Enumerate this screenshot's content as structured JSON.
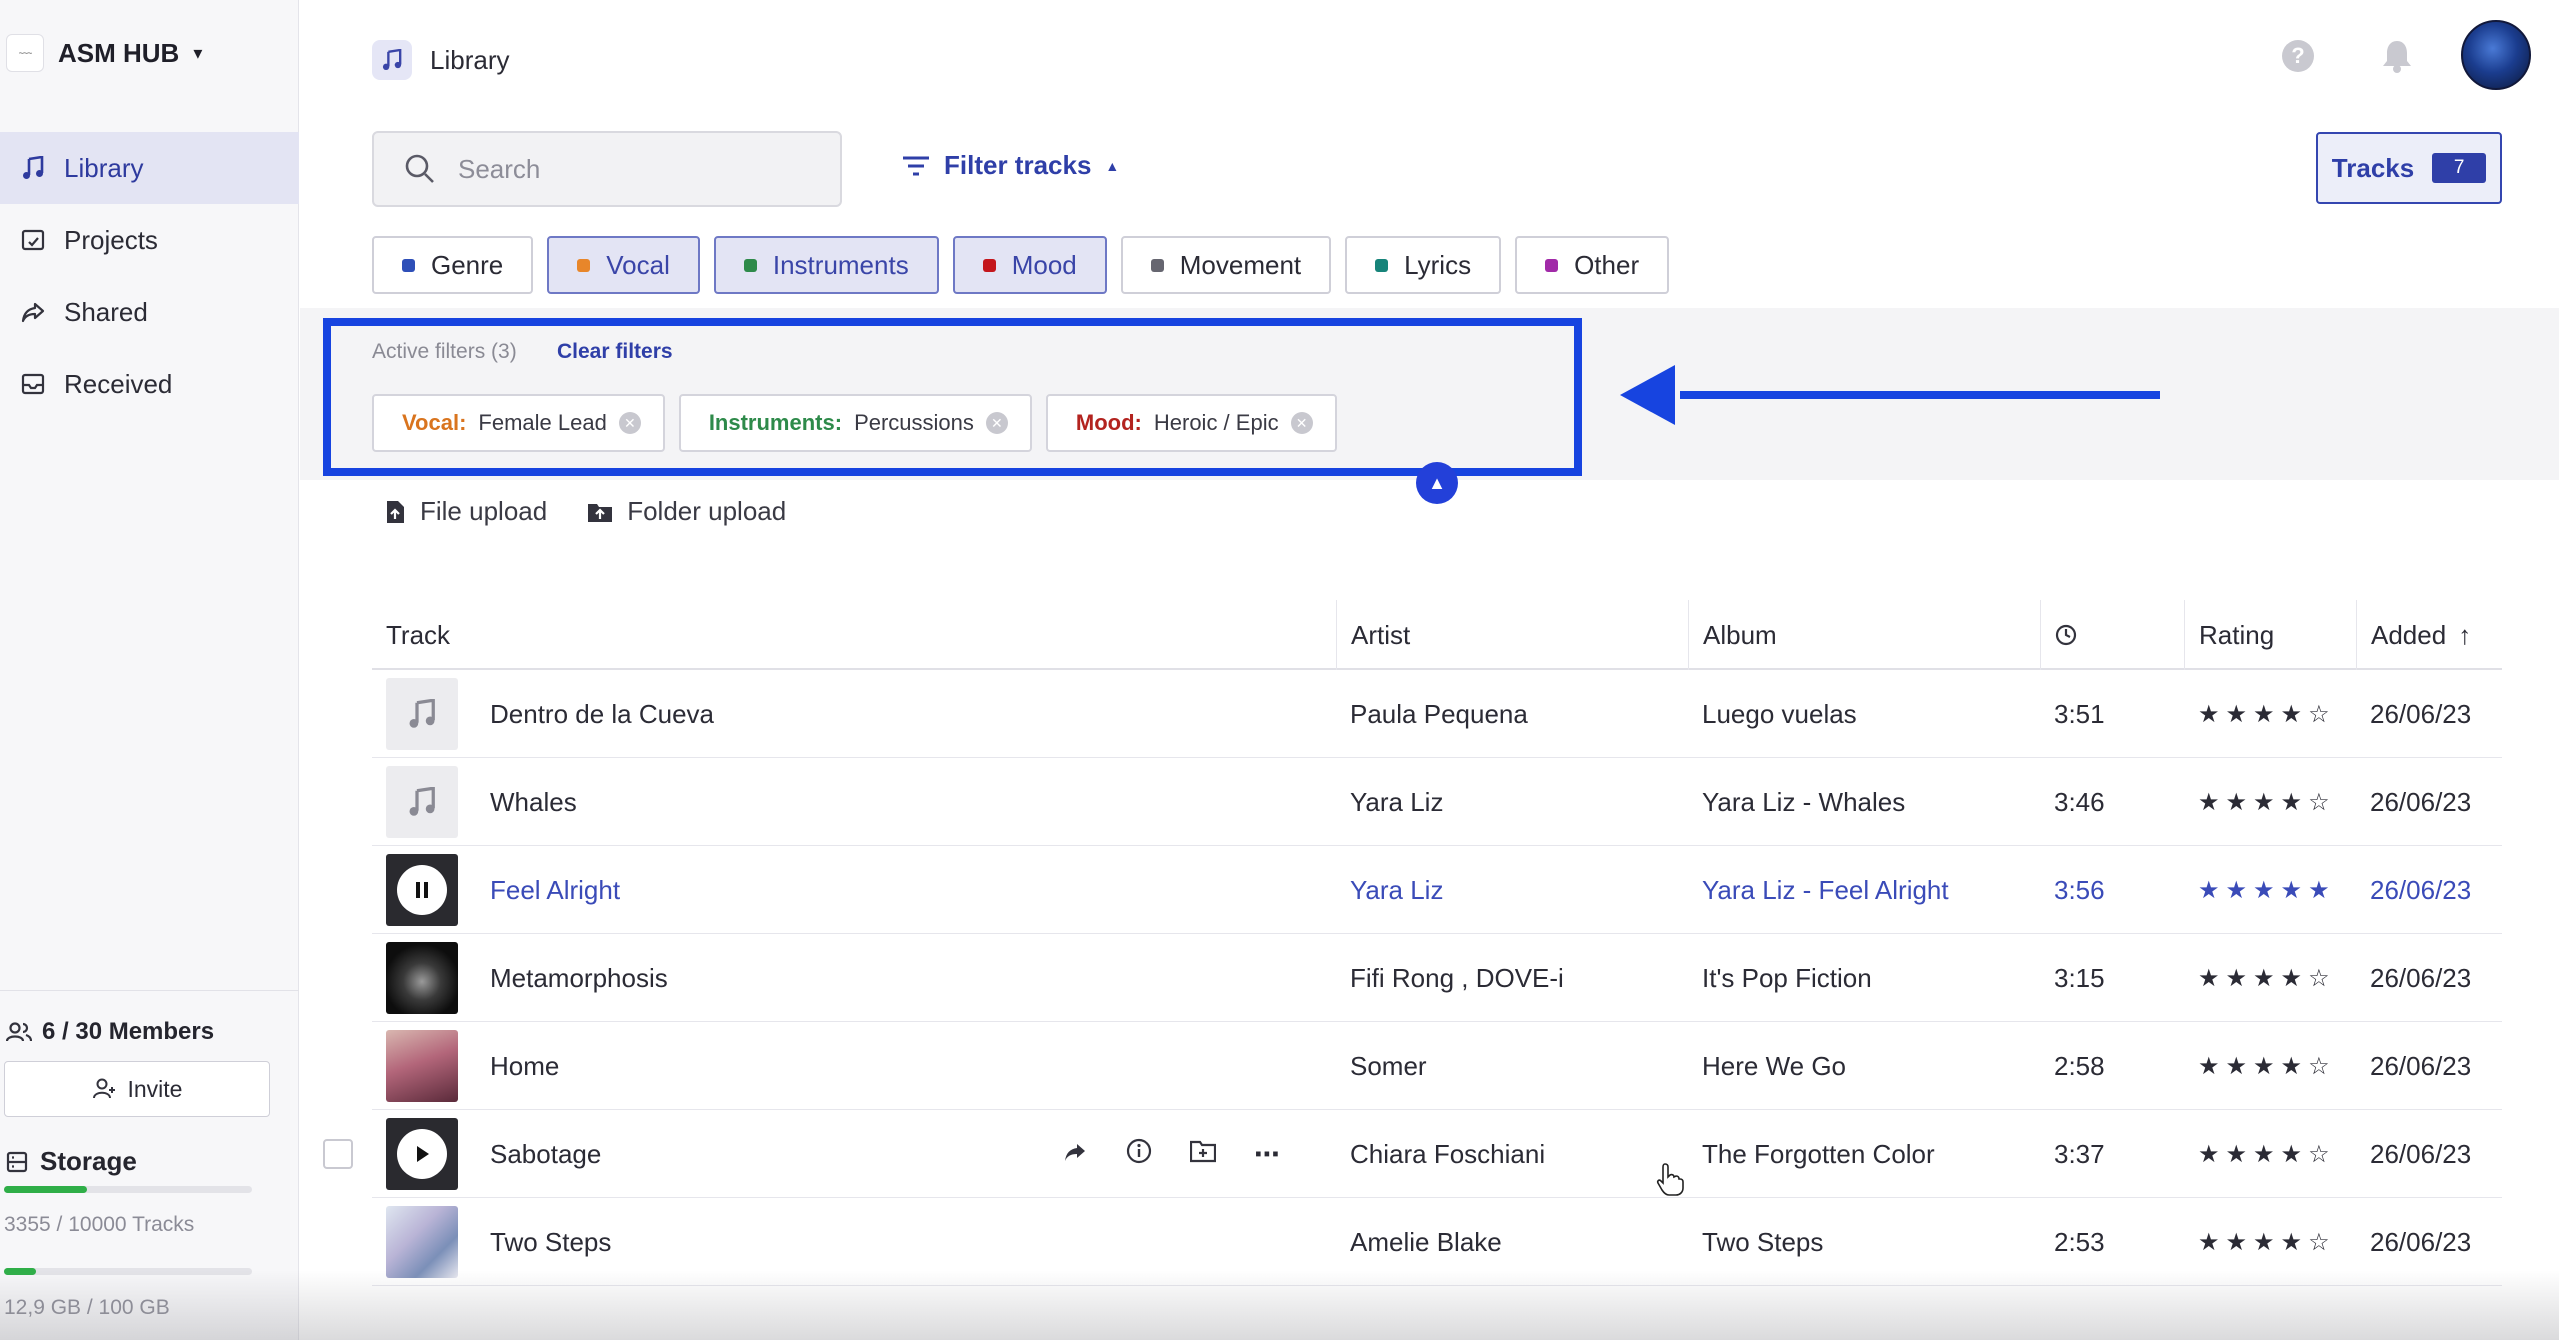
{
  "brand": {
    "name": "ASM HUB",
    "logo_text": "~~~"
  },
  "sidebar": {
    "items": [
      {
        "label": "Library",
        "icon": "music-note-icon",
        "active": true
      },
      {
        "label": "Projects",
        "icon": "project-icon",
        "active": false
      },
      {
        "label": "Shared",
        "icon": "share-icon",
        "active": false
      },
      {
        "label": "Received",
        "icon": "inbox-icon",
        "active": false
      }
    ],
    "members": "6 / 30 Members",
    "invite_label": "Invite",
    "storage_title": "Storage",
    "tracks_usage": "3355 / 10000 Tracks",
    "tracks_usage_fraction": 0.3355,
    "space_usage": "12,9 GB / 100 GB",
    "space_usage_fraction": 0.129
  },
  "header": {
    "breadcrumb": "Library"
  },
  "search": {
    "placeholder": "Search"
  },
  "filter_tracks_label": "Filter tracks",
  "tracks_button": {
    "label": "Tracks",
    "count": "7"
  },
  "filter_chips": [
    {
      "label": "Genre",
      "color": "#2e4fb8",
      "selected": false
    },
    {
      "label": "Vocal",
      "color": "#e8862a",
      "selected": true
    },
    {
      "label": "Instruments",
      "color": "#2e8a4a",
      "selected": true
    },
    {
      "label": "Mood",
      "color": "#c4161c",
      "selected": true
    },
    {
      "label": "Movement",
      "color": "#666670",
      "selected": false
    },
    {
      "label": "Lyrics",
      "color": "#17847a",
      "selected": false
    },
    {
      "label": "Other",
      "color": "#a12aa8",
      "selected": false
    }
  ],
  "active_filters": {
    "label": "Active filters (3)",
    "clear_label": "Clear filters",
    "tags": [
      {
        "key": "Vocal:",
        "value": "Female Lead",
        "color": "#d9741e"
      },
      {
        "key": "Instruments:",
        "value": "Percussions",
        "color": "#2e8a4a"
      },
      {
        "key": "Mood:",
        "value": "Heroic / Epic",
        "color": "#b3231f"
      }
    ]
  },
  "uploads": {
    "file": "File upload",
    "folder": "Folder upload"
  },
  "table": {
    "columns": {
      "track": "Track",
      "artist": "Artist",
      "album": "Album",
      "rating": "Rating",
      "added": "Added"
    },
    "rows": [
      {
        "track": "Dentro de la Cueva",
        "artist": "Paula Pequena",
        "album": "Luego vuelas",
        "duration": "3:51",
        "rating": 4,
        "added": "26/06/23",
        "thumb": "note"
      },
      {
        "track": "Whales",
        "artist": "Yara Liz",
        "album": "Yara Liz - Whales",
        "duration": "3:46",
        "rating": 4,
        "added": "26/06/23",
        "thumb": "note"
      },
      {
        "track": "Feel Alright",
        "artist": "Yara Liz",
        "album": "Yara Liz - Feel Alright",
        "duration": "3:56",
        "rating": 5,
        "added": "26/06/23",
        "thumb": "pause",
        "playing": true
      },
      {
        "track": "Metamorphosis",
        "artist": "Fifi Rong , DOVE-i",
        "album": "It's Pop Fiction",
        "duration": "3:15",
        "rating": 4,
        "added": "26/06/23",
        "thumb": "art-dark"
      },
      {
        "track": "Home",
        "artist": "Somer",
        "album": "Here We Go",
        "duration": "2:58",
        "rating": 4,
        "added": "26/06/23",
        "thumb": "art-sunset"
      },
      {
        "track": "Sabotage",
        "artist": "Chiara Foschiani",
        "album": "The Forgotten Color",
        "duration": "3:37",
        "rating": 4,
        "added": "26/06/23",
        "thumb": "play",
        "hovered": true
      },
      {
        "track": "Two Steps",
        "artist": "Amelie Blake",
        "album": "Two Steps",
        "duration": "2:53",
        "rating": 4,
        "added": "26/06/23",
        "thumb": "art-light"
      }
    ]
  },
  "colors": {
    "accent": "#2f3fa8",
    "highlight_box": "#1744e0",
    "storage_bar": "#2fae48"
  }
}
